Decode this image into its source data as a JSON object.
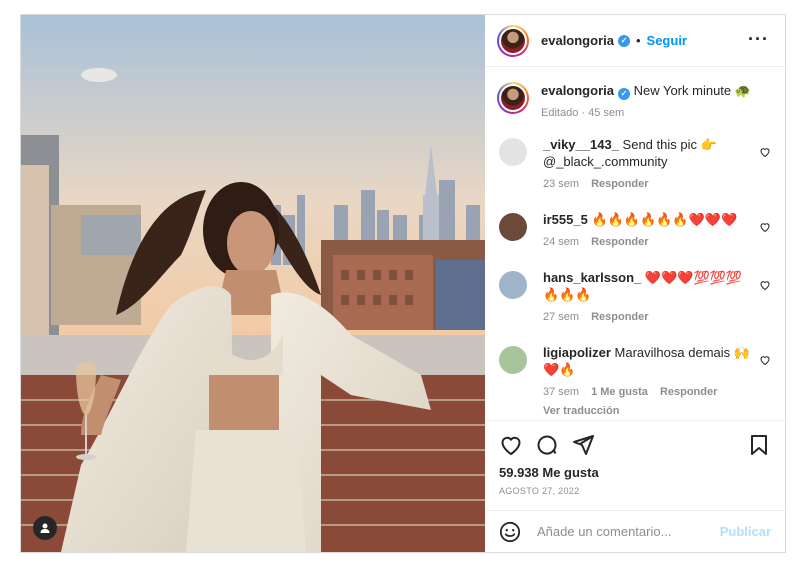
{
  "post": {
    "author": {
      "username": "evalongoria",
      "verified_icon": "verified-badge-icon",
      "follow_label": "Seguir",
      "separator": "•"
    },
    "menu_icon": "more-options-icon",
    "caption": {
      "username": "evalongoria",
      "text": "New York minute 🐢",
      "meta": "Editado · 45 sem"
    },
    "comments": [
      {
        "username": "_viky__143_",
        "text": "Send this pic 👉 @_black_.community",
        "time": "23 sem",
        "reply": "Responder",
        "likes": "",
        "avatar_color": "#e3e3e3"
      },
      {
        "username": "ir555_5",
        "text": "🔥🔥🔥🔥🔥🔥❤️❤️❤️",
        "time": "24 sem",
        "reply": "Responder",
        "likes": "",
        "avatar_color": "#6b4a3a"
      },
      {
        "username": "hans_karlsson_",
        "text": "❤️❤️❤️💯💯💯 🔥🔥🔥",
        "time": "27 sem",
        "reply": "Responder",
        "likes": "",
        "avatar_color": "#9fb4c8"
      },
      {
        "username": "ligiapolizer",
        "text": "Maravilhosa demais 🙌 ❤️🔥",
        "time": "37 sem",
        "reply": "Responder",
        "likes": "1 Me gusta",
        "avatar_color": "#a8c49a",
        "translate": "Ver traducción"
      }
    ],
    "likes": "59.938 Me gusta",
    "date": "AGOSTO 27, 2022",
    "add_comment": {
      "placeholder": "Añade un comentario...",
      "publish": "Publicar"
    },
    "colors": {
      "accent": "#0095f6",
      "publish_disabled": "#b2dffc",
      "text": "#262626",
      "muted": "#8e8e8e",
      "border": "#dbdbdb"
    }
  }
}
